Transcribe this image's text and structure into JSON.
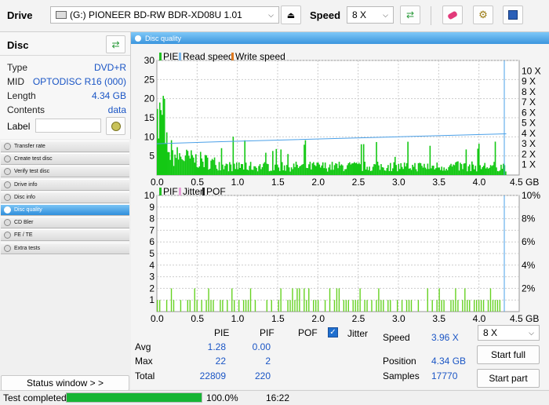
{
  "toolbar": {
    "drive_label": "Drive",
    "drive_value": "(G:)   PIONEER BD-RW  BDR-XD08U 1.01",
    "speed_label": "Speed",
    "speed_value": "8 X"
  },
  "disc": {
    "title": "Disc",
    "type_label": "Type",
    "type_value": "DVD+R",
    "mid_label": "MID",
    "mid_value": "OPTODISC R16 (000)",
    "length_label": "Length",
    "length_value": "4.34 GB",
    "contents_label": "Contents",
    "contents_value": "data",
    "label_label": "Label",
    "label_value": ""
  },
  "nav": {
    "items": [
      "Transfer rate",
      "Create test disc",
      "Verify test disc",
      "Drive info",
      "Disc info",
      "Disc quality",
      "CD Bler",
      "FE / TE",
      "Extra tests"
    ],
    "active": "Disc quality"
  },
  "status_window": "Status window > >",
  "main": {
    "title": "Disc quality"
  },
  "chart_data": [
    {
      "type": "bar",
      "legend": [
        "PIE",
        "Read speed",
        "Write speed"
      ],
      "x_ticks": [
        "0.0",
        "0.5",
        "1.0",
        "1.5",
        "2.0",
        "2.5",
        "3.0",
        "3.5",
        "4.0",
        "4.5 GB"
      ],
      "y_ticks_left": [
        "30",
        "25",
        "20",
        "15",
        "10",
        "5"
      ],
      "y_ticks_right": [
        "10 X",
        "9 X",
        "8 X",
        "7 X",
        "6 X",
        "5 X",
        "4 X",
        "3 X",
        "2 X",
        "1 X"
      ],
      "xlim": [
        0,
        4.5
      ],
      "ylim": [
        0,
        30
      ],
      "read_speed_x": [
        0.0,
        0.8,
        4.34
      ],
      "read_speed_y": [
        3.0,
        3.2,
        3.96
      ],
      "pie_max": 22,
      "pie_avg": 1.28
    },
    {
      "type": "bar",
      "legend": [
        "PIF",
        "Jitter",
        "POF"
      ],
      "x_ticks": [
        "0.0",
        "0.5",
        "1.0",
        "1.5",
        "2.0",
        "2.5",
        "3.0",
        "3.5",
        "4.0",
        "4.5 GB"
      ],
      "y_ticks_left": [
        "10",
        "9",
        "8",
        "7",
        "6",
        "5",
        "4",
        "3",
        "2",
        "1"
      ],
      "y_ticks_right": [
        "10%",
        "8%",
        "6%",
        "4%",
        "2%"
      ],
      "xlim": [
        0,
        4.5
      ],
      "ylim": [
        0,
        10
      ],
      "pif_max": 2
    }
  ],
  "stats": {
    "col_pie": "PIE",
    "col_pif": "PIF",
    "col_pof": "POF",
    "col_jitter": "Jitter",
    "avg_label": "Avg",
    "avg_pie": "1.28",
    "avg_pif": "0.00",
    "max_label": "Max",
    "max_pie": "22",
    "max_pif": "2",
    "total_label": "Total",
    "total_pie": "22809",
    "total_pif": "220",
    "speed_label": "Speed",
    "speed_value": "3.96 X",
    "speed_select": "8 X",
    "position_label": "Position",
    "position_value": "4.34 GB",
    "samples_label": "Samples",
    "samples_value": "17770",
    "start_full": "Start full",
    "start_part": "Start part"
  },
  "status": {
    "text": "Test completed",
    "progress": 1.0,
    "progress_text": "100.0%",
    "time": "16:22"
  }
}
